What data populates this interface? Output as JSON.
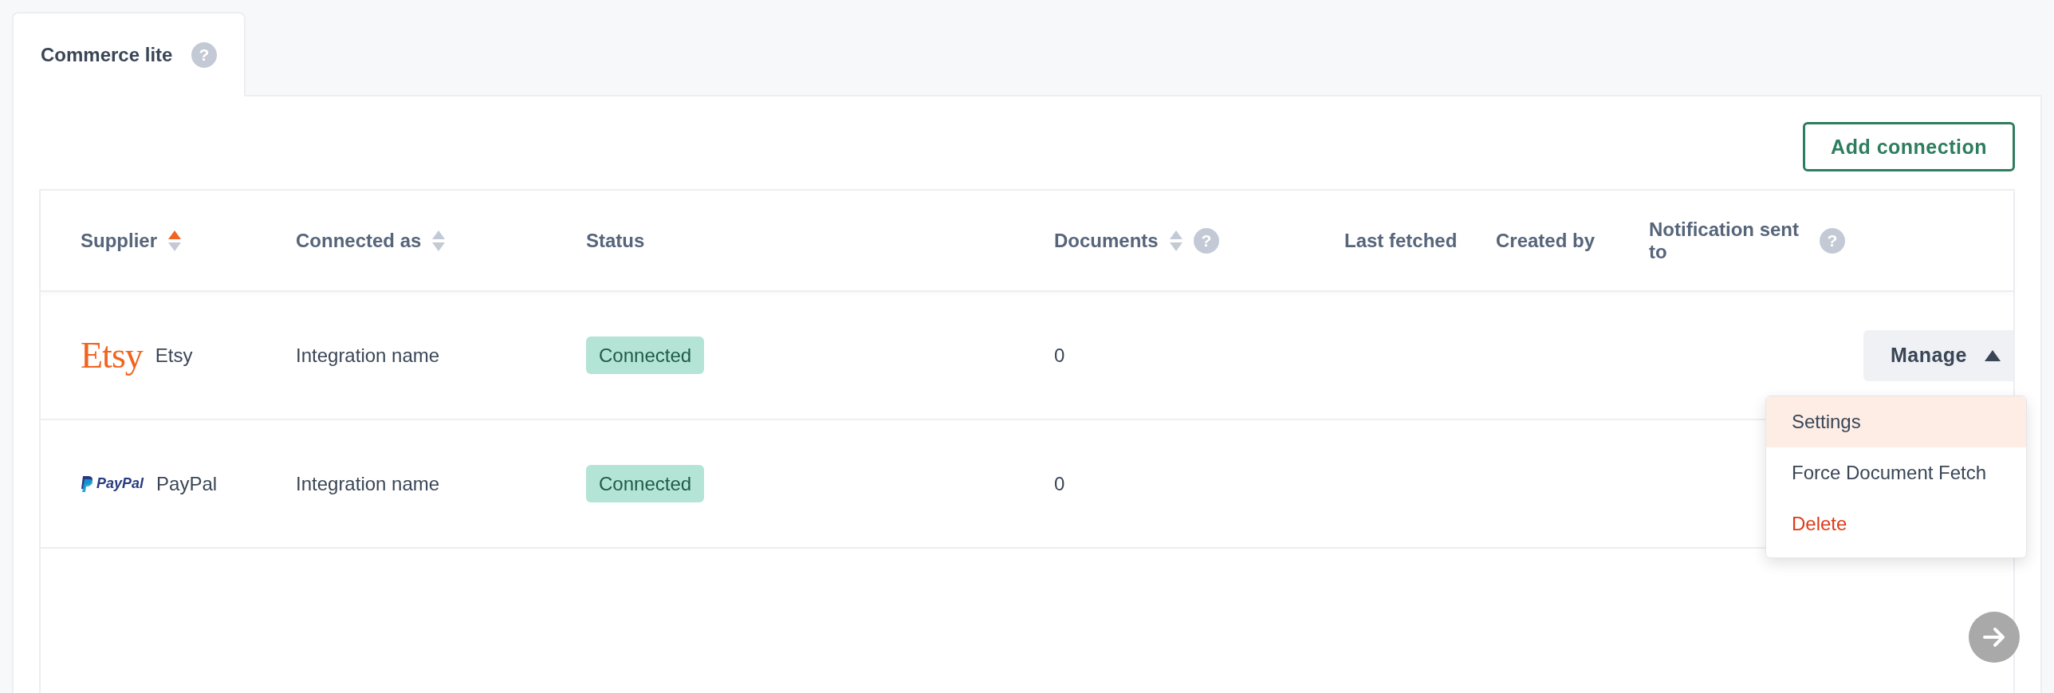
{
  "tabs": [
    {
      "label": "Commerce lite",
      "selected": true,
      "help": "?"
    }
  ],
  "toolbar": {
    "add_button": "Add connection"
  },
  "table": {
    "columns": [
      {
        "label": "Supplier",
        "sortable": true,
        "sorted": true
      },
      {
        "label": "Connected as",
        "sortable": true,
        "sorted": false
      },
      {
        "label": "Status"
      },
      {
        "label": "Documents",
        "sortable": true,
        "sorted": false,
        "help": "?"
      },
      {
        "label": "Last fetched"
      },
      {
        "label": "Created by"
      },
      {
        "label": "Notification sent to",
        "help": "?"
      }
    ],
    "rows": [
      {
        "kind": "etsy",
        "logo_text": "Etsy",
        "supplier": "Etsy",
        "connected_as": "Integration name",
        "status": "Connected",
        "documents": "0",
        "manage": {
          "label": "Manage",
          "expanded": true,
          "menu": [
            {
              "label": "Settings",
              "kind": "normal",
              "selected": true
            },
            {
              "label": "Force Document Fetch",
              "kind": "normal",
              "selected": false
            },
            {
              "label": "Delete",
              "kind": "danger",
              "selected": false
            }
          ]
        }
      },
      {
        "kind": "paypal",
        "logo_text": "PayPal",
        "supplier": "PayPal",
        "connected_as": "Integration name",
        "status": "Connected",
        "documents": "0"
      }
    ]
  }
}
